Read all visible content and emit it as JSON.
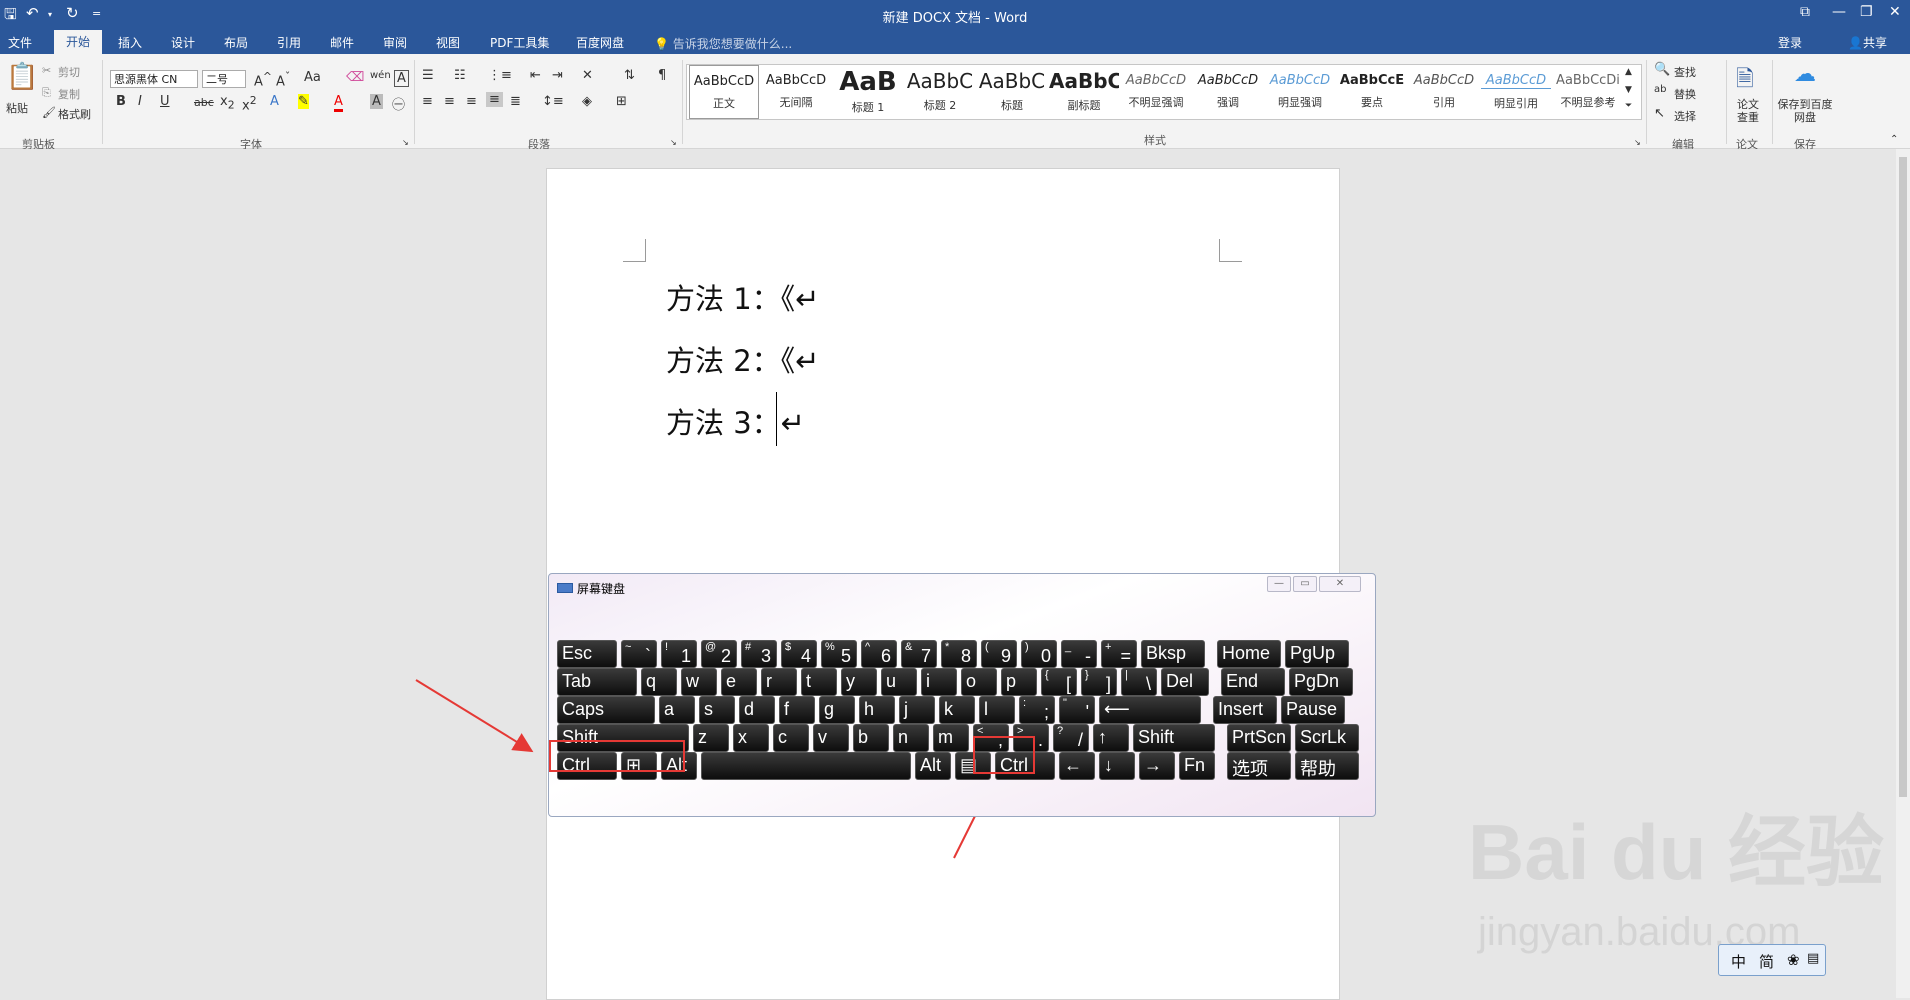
{
  "window": {
    "title": "新建 DOCX 文档 - Word"
  },
  "quick_access": {
    "save": "🖫",
    "undo": "↶",
    "redo": "↻",
    "customize": "="
  },
  "window_controls": {
    "ribbon_options": "⧉",
    "minimize": "—",
    "restore": "❐",
    "close": "✕"
  },
  "tabs": [
    "文件",
    "开始",
    "插入",
    "设计",
    "布局",
    "引用",
    "邮件",
    "审阅",
    "视图",
    "PDF工具集",
    "百度网盘"
  ],
  "active_tab": "开始",
  "tell_me": "告诉我您想要做什么...",
  "account": {
    "login": "登录",
    "share": "共享"
  },
  "ribbon": {
    "clipboard": {
      "label": "剪贴板",
      "paste": "粘贴",
      "cut": "剪切",
      "copy": "复制",
      "format_painter": "格式刷"
    },
    "font": {
      "label": "字体",
      "font_name": "思源黑体 CN",
      "font_size": "二号",
      "case": "Aa"
    },
    "paragraph": {
      "label": "段落"
    },
    "styles": {
      "label": "样式",
      "items": [
        {
          "preview": "AaBbCcD",
          "name": "正文"
        },
        {
          "preview": "AaBbCcD",
          "name": "无间隔"
        },
        {
          "preview": "AaB",
          "name": "标题 1"
        },
        {
          "preview": "AaBbC",
          "name": "标题 2"
        },
        {
          "preview": "AaBbC",
          "name": "标题"
        },
        {
          "preview": "AaBbC",
          "name": "副标题"
        },
        {
          "preview": "AaBbCcD",
          "name": "不明显强调"
        },
        {
          "preview": "AaBbCcD",
          "name": "强调"
        },
        {
          "preview": "AaBbCcD",
          "name": "明显强调"
        },
        {
          "preview": "AaBbCcE",
          "name": "要点"
        },
        {
          "preview": "AaBbCcD",
          "name": "引用"
        },
        {
          "preview": "AaBbCcD",
          "name": "明显引用"
        },
        {
          "preview": "AaBbCcDi",
          "name": "不明显参考"
        }
      ]
    },
    "editing": {
      "label": "编辑",
      "find": "查找",
      "replace": "替换",
      "select": "选择"
    },
    "paper": {
      "label": "论文",
      "check": "论文查重"
    },
    "save": {
      "label": "保存",
      "save_to": "保存到百度网盘"
    }
  },
  "document": {
    "lines": [
      "方法 1：《↵",
      "方法 2：《↵",
      "方法 3：↵"
    ]
  },
  "osk": {
    "title": "屏幕键盘",
    "rows": [
      [
        {
          "m": "Esc"
        },
        {
          "s": "~",
          "m": "`"
        },
        {
          "s": "!",
          "m": "1"
        },
        {
          "s": "@",
          "m": "2"
        },
        {
          "s": "#",
          "m": "3"
        },
        {
          "s": "$",
          "m": "4"
        },
        {
          "s": "%",
          "m": "5"
        },
        {
          "s": "^",
          "m": "6"
        },
        {
          "s": "&",
          "m": "7"
        },
        {
          "s": "*",
          "m": "8"
        },
        {
          "s": "(",
          "m": "9"
        },
        {
          "s": ")",
          "m": "0"
        },
        {
          "s": "_",
          "m": "-"
        },
        {
          "s": "+",
          "m": "="
        },
        {
          "m": "Bksp"
        },
        {
          "m": "Home"
        },
        {
          "m": "PgUp"
        }
      ],
      [
        {
          "m": "Tab"
        },
        {
          "m": "q"
        },
        {
          "m": "w"
        },
        {
          "m": "e"
        },
        {
          "m": "r"
        },
        {
          "m": "t"
        },
        {
          "m": "y"
        },
        {
          "m": "u"
        },
        {
          "m": "i"
        },
        {
          "m": "o"
        },
        {
          "m": "p"
        },
        {
          "s": "{",
          "m": "["
        },
        {
          "s": "}",
          "m": "]"
        },
        {
          "s": "|",
          "m": "\\"
        },
        {
          "m": "Del"
        },
        {
          "m": "End"
        },
        {
          "m": "PgDn"
        }
      ],
      [
        {
          "m": "Caps"
        },
        {
          "m": "a"
        },
        {
          "m": "s"
        },
        {
          "m": "d"
        },
        {
          "m": "f"
        },
        {
          "m": "g"
        },
        {
          "m": "h"
        },
        {
          "m": "j"
        },
        {
          "m": "k"
        },
        {
          "m": "l"
        },
        {
          "s": ":",
          "m": ";"
        },
        {
          "s": "\"",
          "m": "'"
        },
        {
          "m": "⟵"
        },
        {
          "m": "Insert"
        },
        {
          "m": "Pause"
        }
      ],
      [
        {
          "m": "Shift"
        },
        {
          "m": "z"
        },
        {
          "m": "x"
        },
        {
          "m": "c"
        },
        {
          "m": "v"
        },
        {
          "m": "b"
        },
        {
          "m": "n"
        },
        {
          "m": "m"
        },
        {
          "s": "<",
          "m": ","
        },
        {
          "s": ">",
          "m": "."
        },
        {
          "s": "?",
          "m": "/"
        },
        {
          "m": "↑"
        },
        {
          "m": "Shift"
        },
        {
          "m": "PrtScn"
        },
        {
          "m": "ScrLk"
        }
      ],
      [
        {
          "m": "Ctrl"
        },
        {
          "m": "⊞"
        },
        {
          "m": "Alt"
        },
        {
          "m": ""
        },
        {
          "m": "Alt"
        },
        {
          "m": "▤"
        },
        {
          "m": "Ctrl"
        },
        {
          "m": "←"
        },
        {
          "m": "↓"
        },
        {
          "m": "→"
        },
        {
          "m": "Fn"
        },
        {
          "m": "选项"
        },
        {
          "m": "帮助"
        }
      ]
    ]
  },
  "watermark": {
    "brand": "Bai du 经验",
    "url": "jingyan.baidu.com"
  },
  "ime": {
    "mode": "中",
    "script": "简"
  }
}
